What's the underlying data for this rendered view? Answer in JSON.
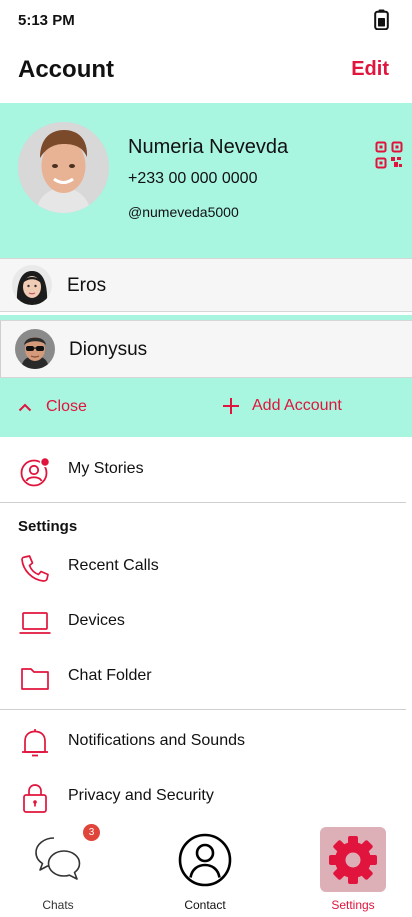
{
  "status_bar": {
    "time": "5:13 PM",
    "battery_icon": "battery-icon"
  },
  "header": {
    "title": "Account",
    "edit_label": "Edit"
  },
  "profile": {
    "name": "Numeria Nevevda",
    "phone": "+233 00 000 0000",
    "handle": "@numeveda5000",
    "qr_icon": "qr-code-icon"
  },
  "accounts": [
    {
      "name": "Eros"
    },
    {
      "name": "Dionysus"
    }
  ],
  "actions": {
    "close_label": "Close",
    "add_label": "Add Account"
  },
  "menu": {
    "stories": {
      "label": "My Stories",
      "icon": "stories-icon"
    },
    "settings_title": "Settings",
    "items": [
      {
        "label": "Recent Calls",
        "icon": "phone-icon"
      },
      {
        "label": "Devices",
        "icon": "laptop-icon"
      },
      {
        "label": "Chat Folder",
        "icon": "folder-icon"
      },
      {
        "label": "Notifications and Sounds",
        "icon": "bell-icon"
      },
      {
        "label": "Privacy and Security",
        "icon": "lock-icon"
      }
    ]
  },
  "bottom_nav": {
    "chats": {
      "label": "Chats",
      "badge": "3"
    },
    "contact": {
      "label": "Contact"
    },
    "settings": {
      "label": "Settings"
    }
  },
  "colors": {
    "accent": "#e0143c",
    "mint": "#a8f5e0",
    "badge": "#e0453c",
    "settings_highlight": "#ddb0b8"
  }
}
